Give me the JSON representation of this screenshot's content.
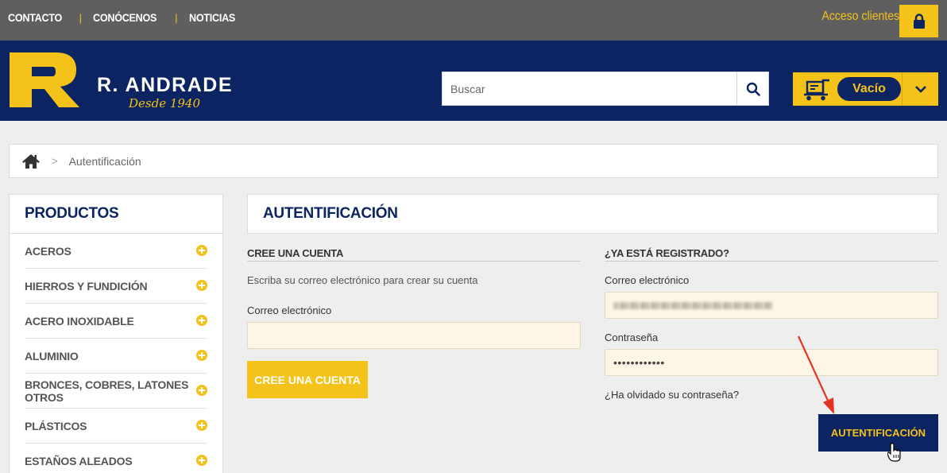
{
  "topbar": {
    "links": [
      "CONTACTO",
      "CONÓCENOS",
      "NOTICIAS"
    ],
    "separator": "|",
    "access_label": "Acceso clientes",
    "lock_icon": "lock-icon"
  },
  "brand": {
    "name": "R. ANDRADE",
    "tagline": "Desde 1940"
  },
  "search": {
    "placeholder": "Buscar",
    "value": ""
  },
  "cart": {
    "status": "Vacío"
  },
  "breadcrumb": {
    "separator": ">",
    "current": "Autentificación"
  },
  "sidebar": {
    "title": "PRODUCTOS",
    "items": [
      "ACEROS",
      "HIERROS Y FUNDICIÓN",
      "ACERO INOXIDABLE",
      "ALUMINIO",
      "BRONCES, COBRES, LATONES OTROS",
      "PLÁSTICOS",
      "ESTAÑOS ALEADOS"
    ]
  },
  "main": {
    "title": "AUTENTIFICACIÓN",
    "create": {
      "heading": "CREE UNA CUENTA",
      "hint": "Escriba su correo electrónico para crear su cuenta",
      "email_label": "Correo electrónico",
      "email_value": "",
      "button": "CREE UNA CUENTA"
    },
    "login": {
      "heading": "¿YA ESTÁ REGISTRADO?",
      "email_label": "Correo electrónico",
      "password_label": "Contraseña",
      "password_value": "••••••••••••",
      "forgot": "¿Ha olvidado su contraseña?",
      "button": "AUTENTIFICACIÓN"
    }
  },
  "colors": {
    "navy": "#0c2461",
    "yellow": "#f5c21a",
    "topbar": "#5f5f5f",
    "field_bg": "#fdf6e6",
    "arrow": "#e53322"
  }
}
